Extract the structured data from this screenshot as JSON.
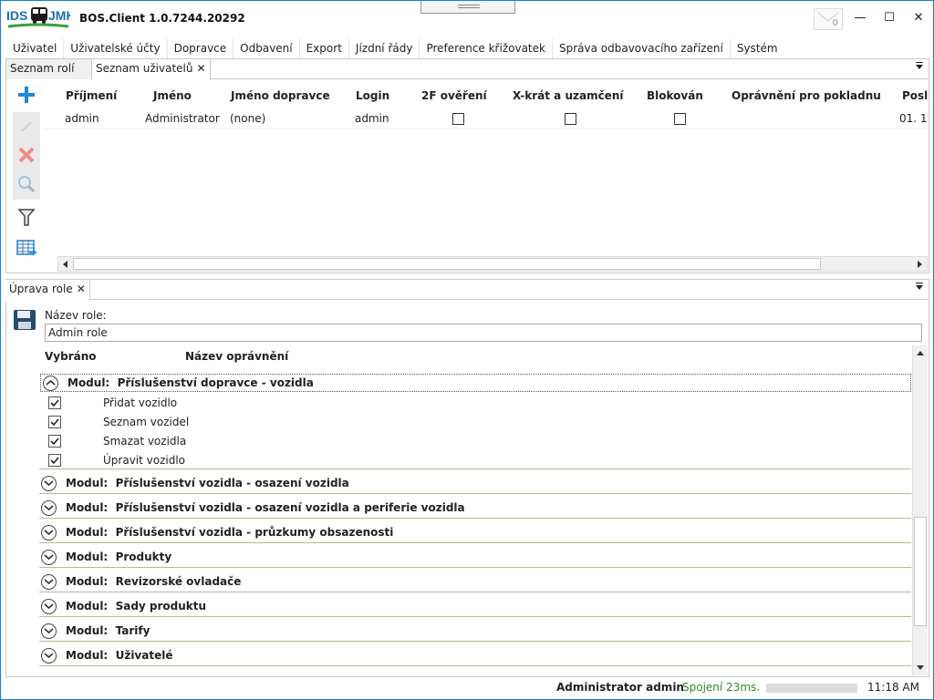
{
  "app": {
    "logo_left": "IDS",
    "logo_right": "JMK",
    "title": "BOS.Client 1.0.7244.20292",
    "mail_count": "0",
    "minimize": "—",
    "maximize": "☐",
    "close": "✕"
  },
  "menu": [
    "Uživatel",
    "Uživatelské účty",
    "Dopravce",
    "Odbavení",
    "Export",
    "Jízdní řády",
    "Preference křižovatek",
    "Správa odbavovacího zařízení",
    "Systém"
  ],
  "top_tabs": [
    {
      "label": "Seznam rolí"
    },
    {
      "label": "Seznam uživatelů",
      "close": "✕"
    }
  ],
  "grid": {
    "headers": [
      "Příjmení",
      "Jméno",
      "Jméno dopravce",
      "Login",
      "2F ověření",
      "X-krát a uzamčení",
      "Blokován",
      "Oprávnění pro pokladnu",
      "Posl"
    ],
    "rows": [
      {
        "prijmeni": "admin",
        "jmeno": "Administrator",
        "dopravce": "(none)",
        "login": "admin",
        "f2": false,
        "xkrat": false,
        "blokovan": false,
        "opravneni": "",
        "posl": "01. 1"
      }
    ]
  },
  "icons": {
    "add": "plus-icon",
    "edit": "edit-icon",
    "delete": "delete-icon",
    "detail": "search-icon",
    "filter": "filter-icon",
    "export": "export-icon",
    "save": "save-icon",
    "accent": "#1e88d8"
  },
  "bottom_tab": {
    "label": "Úprava role",
    "close": "✕"
  },
  "role": {
    "label": "Název role:",
    "value": "Admin role",
    "col_selected": "Vybráno",
    "col_name": "Název oprávnění"
  },
  "modules": [
    {
      "prefix": "Modul:",
      "name": "Příslušenství dopravce - vozidla",
      "expanded": true,
      "items": [
        {
          "label": "Přidat vozidlo",
          "checked": true
        },
        {
          "label": "Seznam vozidel",
          "checked": true
        },
        {
          "label": "Smazat vozidla",
          "checked": true
        },
        {
          "label": "Úpravit vozidlo",
          "checked": true
        }
      ]
    },
    {
      "prefix": "Modul:",
      "name": "Příslušenství vozidla - osazení vozidla",
      "expanded": false
    },
    {
      "prefix": "Modul:",
      "name": "Příslušenství vozidla - osazení vozidla a periferie vozidla",
      "expanded": false
    },
    {
      "prefix": "Modul:",
      "name": "Příslušenství vozidla - průzkumy obsazenosti",
      "expanded": false
    },
    {
      "prefix": "Modul:",
      "name": "Produkty",
      "expanded": false
    },
    {
      "prefix": "Modul:",
      "name": "Revizorské ovladače",
      "expanded": false
    },
    {
      "prefix": "Modul:",
      "name": "Sady produktu",
      "expanded": false
    },
    {
      "prefix": "Modul:",
      "name": "Tarify",
      "expanded": false
    },
    {
      "prefix": "Modul:",
      "name": "Uživatelé",
      "expanded": false
    }
  ],
  "status": {
    "user": "Administrator admin",
    "connection": "Spojení 23ms.",
    "time": "11:18 AM"
  }
}
